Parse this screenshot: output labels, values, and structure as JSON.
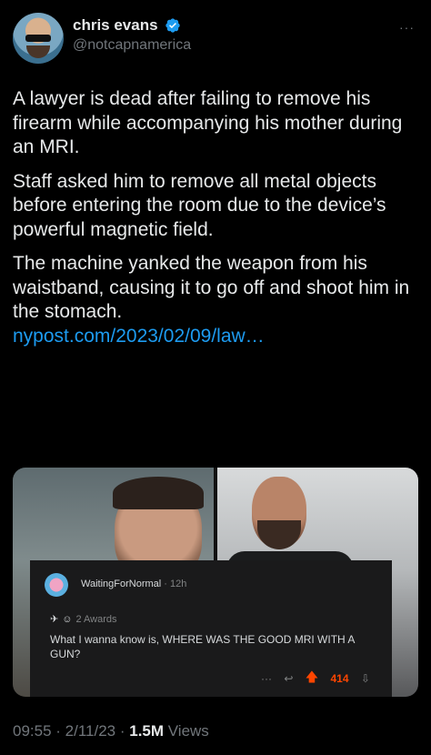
{
  "author": {
    "display_name": "chris evans",
    "handle": "@notcapnamerica",
    "verified": true,
    "avatar_icon": "profile-avatar-icon"
  },
  "more_label": "···",
  "tweet": {
    "paragraphs": [
      "A lawyer is dead after failing to remove his firearm while accompanying his mother during an MRI.",
      "Staff asked him to remove all metal objects before entering the room due to the device’s powerful magnetic field.",
      "The machine yanked the weapon from his waistband, causing it to go off and shoot him in the stomach."
    ],
    "link_text": "nypost.com/2023/02/09/law…"
  },
  "media": {
    "comment": {
      "username": "WaitingForNormal",
      "time": " · 12h",
      "awards": "2 Awards",
      "text": "What I wanna know is, WHERE WAS THE GOOD MRI WITH A GUN?",
      "more": "···",
      "score": "414"
    }
  },
  "footer": {
    "time": "09:55",
    "sep1": " · ",
    "date": "2/11/23",
    "sep2": " · ",
    "views_count": "1.5M",
    "views_label": " Views"
  },
  "colors": {
    "background": "#000000",
    "text": "#e7e9ea",
    "secondary": "#71767b",
    "link": "#1d9bf0",
    "verified": "#1d9bf0",
    "upvote": "#ff4500"
  }
}
